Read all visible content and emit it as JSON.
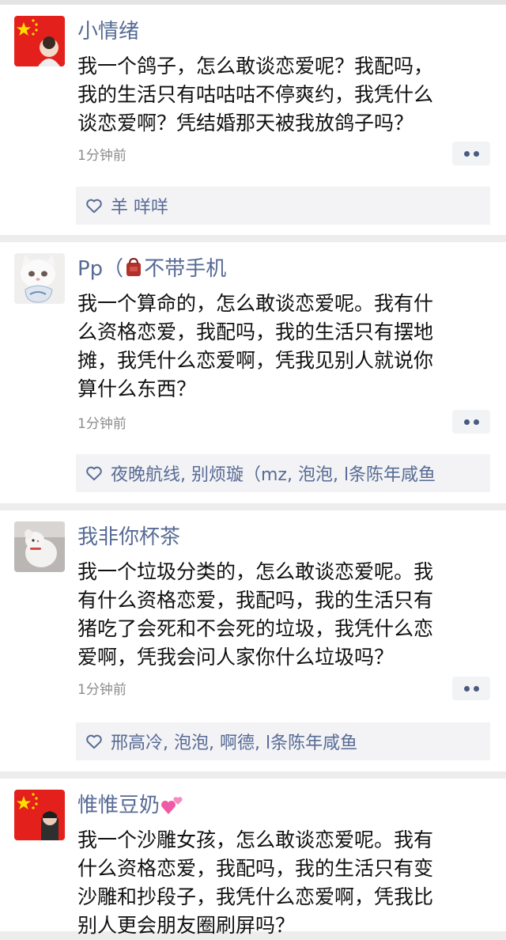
{
  "posts": [
    {
      "avatar": "china-flag-avatar",
      "name": "小情绪",
      "lines": [
        "我一个鸽子，怎么敢谈恋爱呢？我配吗，",
        "我的生活只有咕咕咕不停爽约，我凭什么",
        "谈恋爱啊？凭结婚那天被我放鸽子吗？"
      ],
      "time": "1分钟前",
      "likes": "羊 咩咩"
    },
    {
      "avatar": "white-cat-avatar",
      "name": "Pp（",
      "name_suffix": "不带手机",
      "lines": [
        "我一个算命的，怎么敢谈恋爱呢。我有什",
        "么资格恋爱，我配吗，我的生活只有摆地",
        "摊，我凭什么恋爱啊，凭我见别人就说你",
        "算什么东西？"
      ],
      "time": "1分钟前",
      "likes": "夜晚航线, 别烦璇（mz, 泡泡, l条陈年咸鱼"
    },
    {
      "avatar": "stuffed-toy-avatar",
      "name": "我非你杯茶",
      "lines": [
        "我一个垃圾分类的，怎么敢谈恋爱呢。我",
        "有什么资格恋爱，我配吗，我的生活只有",
        "猪吃了会死和不会死的垃圾，我凭什么恋",
        "爱啊，凭我会问人家你什么垃圾吗？"
      ],
      "time": "1分钟前",
      "likes": "邢高冷, 泡泡, 啊德, l条陈年咸鱼"
    },
    {
      "avatar": "china-flag-avatar",
      "name": "惟惟豆奶",
      "lines": [
        "我一个沙雕女孩，怎么敢谈恋爱呢。我有",
        "什么资格恋爱，我配吗，我的生活只有变",
        "沙雕和抄段子，我凭什么恋爱啊，凭我比",
        "别人更会朋友圈刷屏吗？"
      ]
    }
  ]
}
